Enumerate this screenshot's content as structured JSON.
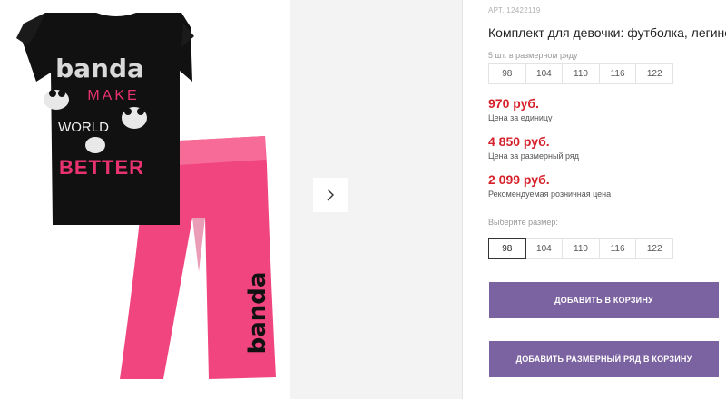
{
  "product": {
    "article": "АРТ. 12422119",
    "title": "Комплект для девочки: футболка, легинсы",
    "size_row_note": "5 шт. в размерном ряду",
    "size_row": [
      "98",
      "104",
      "110",
      "116",
      "122"
    ],
    "prices": [
      {
        "value": "970 руб.",
        "label": "Цена за единицу"
      },
      {
        "value": "4 850 руб.",
        "label": "Цена за размерный ряд"
      },
      {
        "value": "2 099 руб.",
        "label": "Рекомендуемая розничная цена"
      }
    ],
    "choose_size_label": "Выберите размер:",
    "sizes": [
      "98",
      "104",
      "110",
      "116",
      "122"
    ],
    "selected_size": "98",
    "add_to_cart": "ДОБАВИТЬ В КОРЗИНУ",
    "add_size_row_to_cart": "ДОБАВИТЬ РАЗМЕРНЫЙ РЯД В КОРЗИНУ"
  },
  "image": {
    "tshirt_brand": "banda",
    "tshirt_lines": [
      "MAKE",
      "WORLD",
      "BETTER"
    ],
    "leggings_brand": "banda"
  },
  "colors": {
    "accent_price": "#d6212b",
    "button": "#7b62a0",
    "tshirt": "#111111",
    "leggings": "#f0457f",
    "print_pink": "#e8336f"
  },
  "icons": {
    "next": "chevron-right-icon"
  }
}
